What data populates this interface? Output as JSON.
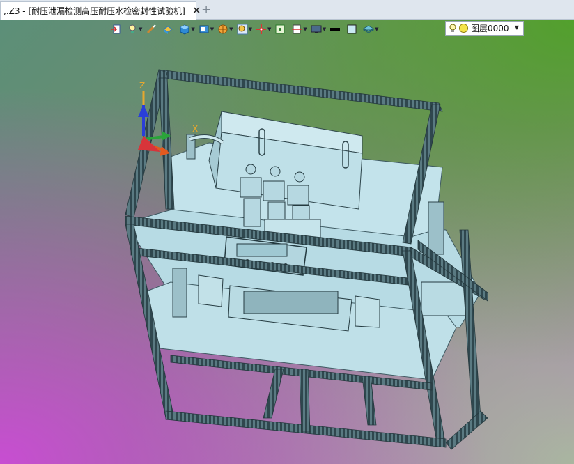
{
  "tab": {
    "title": ",.Z3 - [耐压泄漏检测高压耐压水检密封性试验机]",
    "close_glyph": "✕",
    "add_glyph": "+"
  },
  "toolbar": {
    "buttons": [
      {
        "icon": "import-arrow-icon"
      },
      {
        "icon": "light-bulb-icon",
        "dropdown": true
      },
      {
        "icon": "brush-icon"
      },
      {
        "icon": "shaded-solid-icon"
      },
      {
        "icon": "cube-view-icon",
        "dropdown": true
      },
      {
        "icon": "display-mode-icon",
        "dropdown": true
      },
      {
        "icon": "render-sphere-icon",
        "dropdown": true
      },
      {
        "icon": "zoom-icon",
        "dropdown": true
      },
      {
        "icon": "pan-cross-icon",
        "dropdown": true
      },
      {
        "icon": "image-icon"
      },
      {
        "icon": "section-plane-icon",
        "dropdown": true
      },
      {
        "icon": "monitor-icon",
        "dropdown": true
      },
      {
        "icon": "line-weight-icon"
      },
      {
        "icon": "color-swatch-icon"
      },
      {
        "icon": "layer-stack-icon",
        "dropdown": true
      }
    ]
  },
  "layer": {
    "label": "图层0000",
    "swatch_color": "#f5e44a"
  },
  "axes": {
    "z_label": "Z",
    "x_label": "X",
    "x_color": "#e25a1f",
    "y_color": "#2aa43a",
    "z_color": "#2a3fd8"
  },
  "colors": {
    "model_fill": "#b9dde6",
    "frame": "#3e5a62"
  }
}
